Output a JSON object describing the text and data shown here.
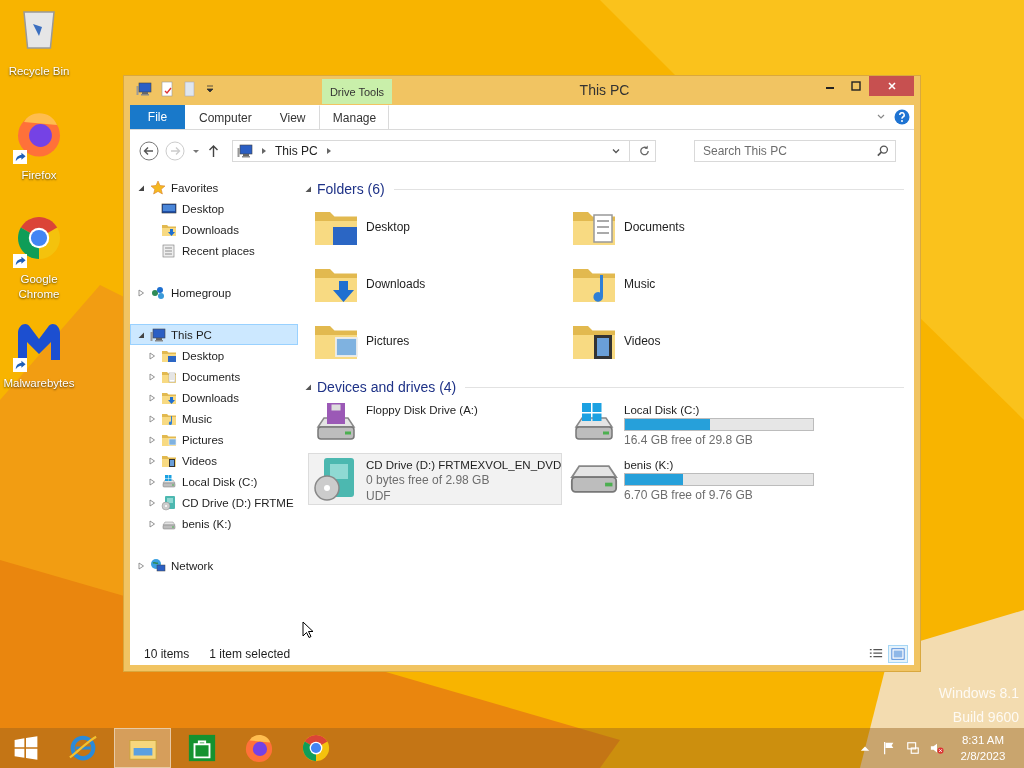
{
  "desktop_icons": [
    {
      "label": "Recycle Bin",
      "kind": "recycle",
      "shortcut": false
    },
    {
      "label": "Firefox",
      "kind": "firefox",
      "shortcut": true
    },
    {
      "label": "Google Chrome",
      "kind": "chrome",
      "shortcut": true
    },
    {
      "label": "Malwarebytes",
      "kind": "malwarebytes",
      "shortcut": true
    }
  ],
  "window": {
    "title": "This PC",
    "ribbon": {
      "file_tab": "File",
      "tabs": [
        {
          "label": "Computer",
          "selected": false
        },
        {
          "label": "View",
          "selected": false
        },
        {
          "label": "Manage",
          "selected": false,
          "context_group": "Drive Tools"
        }
      ]
    },
    "address": {
      "path": "This PC"
    },
    "search": {
      "placeholder": "Search This PC"
    },
    "navigation": [
      {
        "label": "Favorites",
        "kind": "star",
        "expanded": true,
        "selected": false,
        "children": [
          {
            "label": "Desktop",
            "kind": "desktop",
            "selected": false
          },
          {
            "label": "Downloads",
            "kind": "downloads",
            "selected": false
          },
          {
            "label": "Recent places",
            "kind": "recent",
            "selected": false
          }
        ]
      },
      {
        "label": "Homegroup",
        "kind": "homegroup",
        "expanded": false,
        "selected": false
      },
      {
        "label": "This PC",
        "kind": "pc",
        "expanded": true,
        "selected": true,
        "children": [
          {
            "label": "Desktop",
            "kind": "desktop-folder",
            "expanded": false,
            "selected": false
          },
          {
            "label": "Documents",
            "kind": "documents",
            "expanded": false,
            "selected": false
          },
          {
            "label": "Downloads",
            "kind": "downloads",
            "expanded": false,
            "selected": false
          },
          {
            "label": "Music",
            "kind": "music",
            "expanded": false,
            "selected": false
          },
          {
            "label": "Pictures",
            "kind": "pictures",
            "expanded": false,
            "selected": false
          },
          {
            "label": "Videos",
            "kind": "videos",
            "expanded": false,
            "selected": false
          },
          {
            "label": "Local Disk (C:)",
            "kind": "disk-windows",
            "expanded": false,
            "selected": false
          },
          {
            "label": "CD Drive (D:) FRTME",
            "kind": "cd",
            "expanded": false,
            "selected": false
          },
          {
            "label": "benis (K:)",
            "kind": "drive",
            "expanded": false,
            "selected": false
          }
        ]
      },
      {
        "label": "Network",
        "kind": "network",
        "expanded": false,
        "selected": false
      }
    ],
    "folders": {
      "title": "Folders (6)",
      "expanded": true,
      "items": [
        {
          "name": "Desktop",
          "kind": "desktop-folder"
        },
        {
          "name": "Documents",
          "kind": "documents"
        },
        {
          "name": "Downloads",
          "kind": "downloads"
        },
        {
          "name": "Music",
          "kind": "music"
        },
        {
          "name": "Pictures",
          "kind": "pictures"
        },
        {
          "name": "Videos",
          "kind": "videos"
        }
      ]
    },
    "devices": {
      "title": "Devices and drives (4)",
      "expanded": true,
      "items": [
        {
          "name": "Floppy Disk Drive (A:)",
          "kind": "floppy",
          "selected": false
        },
        {
          "name": "Local Disk (C:)",
          "kind": "disk-windows",
          "level": 0.45,
          "free": "16.4 GB free of 29.8 GB",
          "selected": false
        },
        {
          "name": "CD Drive (D:) FRTMEXVOL_EN_DVD",
          "kind": "cd",
          "free": "0 bytes free of 2.98 GB",
          "filesystem": "UDF",
          "selected": true
        },
        {
          "name": "benis (K:)",
          "kind": "drive",
          "level": 0.31,
          "free": "6.70 GB free of 9.76 GB",
          "selected": false
        }
      ]
    },
    "status_bar": {
      "item_count": "10 items",
      "selection": "1 item selected",
      "view_modes": [
        {
          "kind": "details",
          "selected": false
        },
        {
          "kind": "tiles",
          "selected": true
        }
      ]
    }
  },
  "os_label": [
    "Windows 8.1",
    "Build 9600"
  ],
  "taskbar": {
    "apps": [
      {
        "kind": "ie",
        "active": false
      },
      {
        "kind": "explorer",
        "active": true
      },
      {
        "kind": "store",
        "active": false
      },
      {
        "kind": "firefox",
        "active": false
      },
      {
        "kind": "chrome",
        "active": false
      }
    ],
    "clock": {
      "time": "8:31 AM",
      "date": "2/8/2023"
    }
  }
}
